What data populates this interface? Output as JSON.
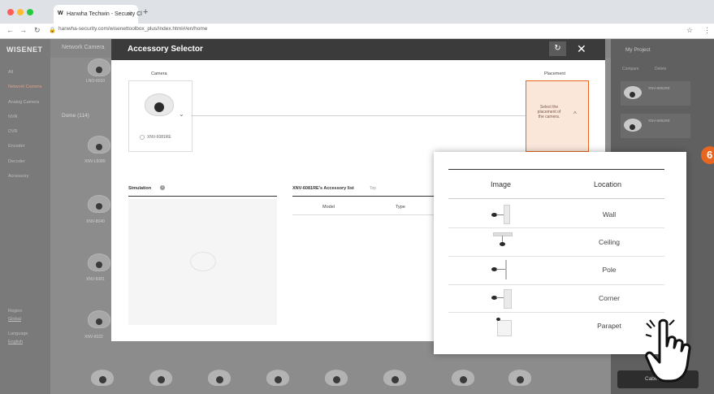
{
  "browser": {
    "tab_title": "Hanwha Techwin - Security Cl",
    "tab_close": "×",
    "new_tab": "+",
    "url": "hanwha-security.com/wisenettoolbox_plus/index.html#/en/home",
    "star": "☆",
    "menu": "⋮"
  },
  "app": {
    "logo": "WISENET",
    "top_nav": "Network Camera",
    "sidebar_items": [
      {
        "label": "All"
      },
      {
        "label": "Network Camera"
      },
      {
        "label": "Analog Camera"
      },
      {
        "label": "NVR"
      },
      {
        "label": "DVR"
      },
      {
        "label": "Encoder"
      },
      {
        "label": "Decoder"
      },
      {
        "label": "Accessory"
      }
    ],
    "sidebar_footer": {
      "region_label": "Region",
      "region_value": "Global",
      "language_label": "Language",
      "language_value": "English"
    },
    "category": "Dome (114)",
    "products": [
      {
        "name": "LNO-6010"
      },
      {
        "name": "XNV-L6080"
      },
      {
        "name": "XNV-8040"
      },
      {
        "name": "XNV-6081"
      },
      {
        "name": "XNV-6022"
      }
    ],
    "project_panel": {
      "title": "My Project",
      "compare": "Compare",
      "delete": "Delete",
      "items": [
        {
          "name": "XNV-8081RE"
        },
        {
          "name": "XNV-6081RE"
        }
      ],
      "cart_button": "Cabinet"
    },
    "step_badge": "6"
  },
  "modal": {
    "title": "Accessory Selector",
    "refresh_icon": "↻",
    "close_icon": "✕",
    "camera_label": "Camera",
    "placement_label": "Placement",
    "camera_model": "XNV-6081RE",
    "placement_prompt": "Select the placement of the camera.",
    "simulation_title": "Simulation",
    "accessory_list_title": "XNV-6081RE's Accessory list",
    "accessory_list_count": "Top",
    "table_headers": {
      "model": "Model",
      "type": "Type"
    }
  },
  "placement_popup": {
    "header_image": "Image",
    "header_location": "Location",
    "rows": [
      {
        "location": "Wall"
      },
      {
        "location": "Ceiling"
      },
      {
        "location": "Pole"
      },
      {
        "location": "Corner"
      },
      {
        "location": "Parapet"
      }
    ]
  }
}
